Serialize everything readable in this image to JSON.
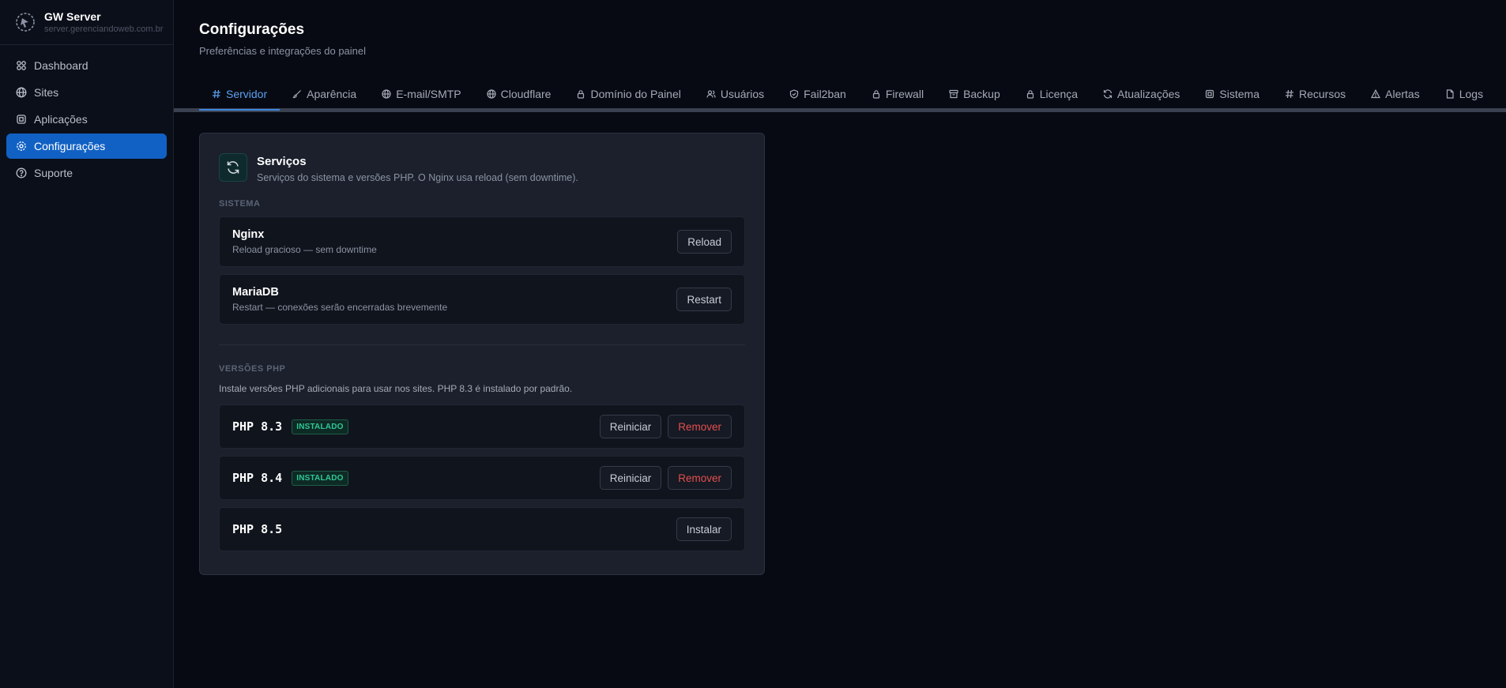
{
  "brand": {
    "title": "GW Server",
    "subtitle": "server.gerenciandoweb.com.br"
  },
  "sidebar": {
    "items": [
      {
        "label": "Dashboard",
        "icon": "grid-icon",
        "active": false
      },
      {
        "label": "Sites",
        "icon": "globe-icon",
        "active": false
      },
      {
        "label": "Aplicações",
        "icon": "chip-icon",
        "active": false
      },
      {
        "label": "Configurações",
        "icon": "gear-icon",
        "active": true
      },
      {
        "label": "Suporte",
        "icon": "help-circle-icon",
        "active": false
      }
    ]
  },
  "header": {
    "title": "Configurações",
    "subtitle": "Preferências e integrações do painel"
  },
  "tabs": [
    {
      "label": "Servidor",
      "icon": "hash-icon",
      "active": true
    },
    {
      "label": "Aparência",
      "icon": "brush-icon"
    },
    {
      "label": "E-mail/SMTP",
      "icon": "globe-icon"
    },
    {
      "label": "Cloudflare",
      "icon": "globe-icon"
    },
    {
      "label": "Domínio do Painel",
      "icon": "lock-icon"
    },
    {
      "label": "Usuários",
      "icon": "users-icon"
    },
    {
      "label": "Fail2ban",
      "icon": "shield-icon"
    },
    {
      "label": "Firewall",
      "icon": "lock-icon"
    },
    {
      "label": "Backup",
      "icon": "archive-icon"
    },
    {
      "label": "Licença",
      "icon": "lock-icon"
    },
    {
      "label": "Atualizações",
      "icon": "refresh-icon"
    },
    {
      "label": "Sistema",
      "icon": "chip-icon"
    },
    {
      "label": "Recursos",
      "icon": "hash-icon"
    },
    {
      "label": "Alertas",
      "icon": "alert-triangle-icon"
    },
    {
      "label": "Logs",
      "icon": "file-icon"
    }
  ],
  "card": {
    "title": "Serviços",
    "description": "Serviços do sistema e versões PHP. O Nginx usa reload (sem downtime).",
    "system_label": "SISTEMA",
    "services": [
      {
        "name": "Nginx",
        "description": "Reload gracioso — sem downtime",
        "action": "Reload"
      },
      {
        "name": "MariaDB",
        "description": "Restart — conexões serão encerradas brevemente",
        "action": "Restart"
      }
    ],
    "php_label": "VERSÕES PHP",
    "php_note": "Instale versões PHP adicionais para usar nos sites. PHP 8.3 é instalado por padrão.",
    "php_versions": [
      {
        "name": "PHP 8.3",
        "badge": "INSTALADO",
        "restart": "Reiniciar",
        "remove": "Remover"
      },
      {
        "name": "PHP 8.4",
        "badge": "INSTALADO",
        "restart": "Reiniciar",
        "remove": "Remover"
      },
      {
        "name": "PHP 8.5",
        "install": "Instalar"
      }
    ]
  },
  "colors": {
    "accent": "#1161c4",
    "tab_active": "#5aa0f0",
    "danger": "#e54e4e",
    "success": "#2ec995"
  }
}
